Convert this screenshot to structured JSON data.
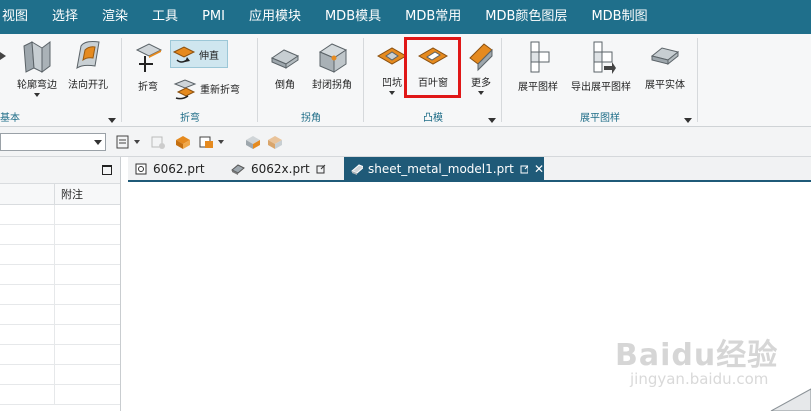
{
  "menu": [
    "视图",
    "选择",
    "渲染",
    "工具",
    "PMI",
    "应用模块",
    "MDB模具",
    "MDB常用",
    "MDB颜色图层",
    "MDB制图"
  ],
  "ribbon": {
    "basic": {
      "label": "基本",
      "buttons": {
        "contour_flange": "轮廓弯边",
        "normal_cutout": "法向开孔"
      }
    },
    "bend": {
      "label": "折弯",
      "buttons": {
        "fold": "折弯",
        "unbend": "伸直",
        "rebend": "重新折弯"
      }
    },
    "corner": {
      "label": "拐角",
      "buttons": {
        "chamfer": "倒角",
        "closed_corner": "封闭拐角"
      }
    },
    "emboss": {
      "label": "凸模",
      "buttons": {
        "dimple": "凹坑",
        "louver": "百叶窗",
        "more": "更多"
      }
    },
    "flat": {
      "label": "展平图样",
      "buttons": {
        "flat_pattern": "展平图样",
        "export_flat": "导出展平图样",
        "flat_solid": "展平实体"
      }
    }
  },
  "left_panel": {
    "col_note": "附注"
  },
  "tabs": [
    {
      "label": "6062.prt"
    },
    {
      "label": "6062x.prt"
    },
    {
      "label": "sheet_metal_model1.prt",
      "close": "✕"
    }
  ],
  "watermark": {
    "logo": "Baidu经验",
    "url": "jingyan.baidu.com"
  },
  "colors": {
    "menubar": "#1f6f8b",
    "group_label": "#1d6c87",
    "active_tab": "#1f5a78",
    "highlight": "#e01717",
    "accent": "#e58a1f"
  }
}
